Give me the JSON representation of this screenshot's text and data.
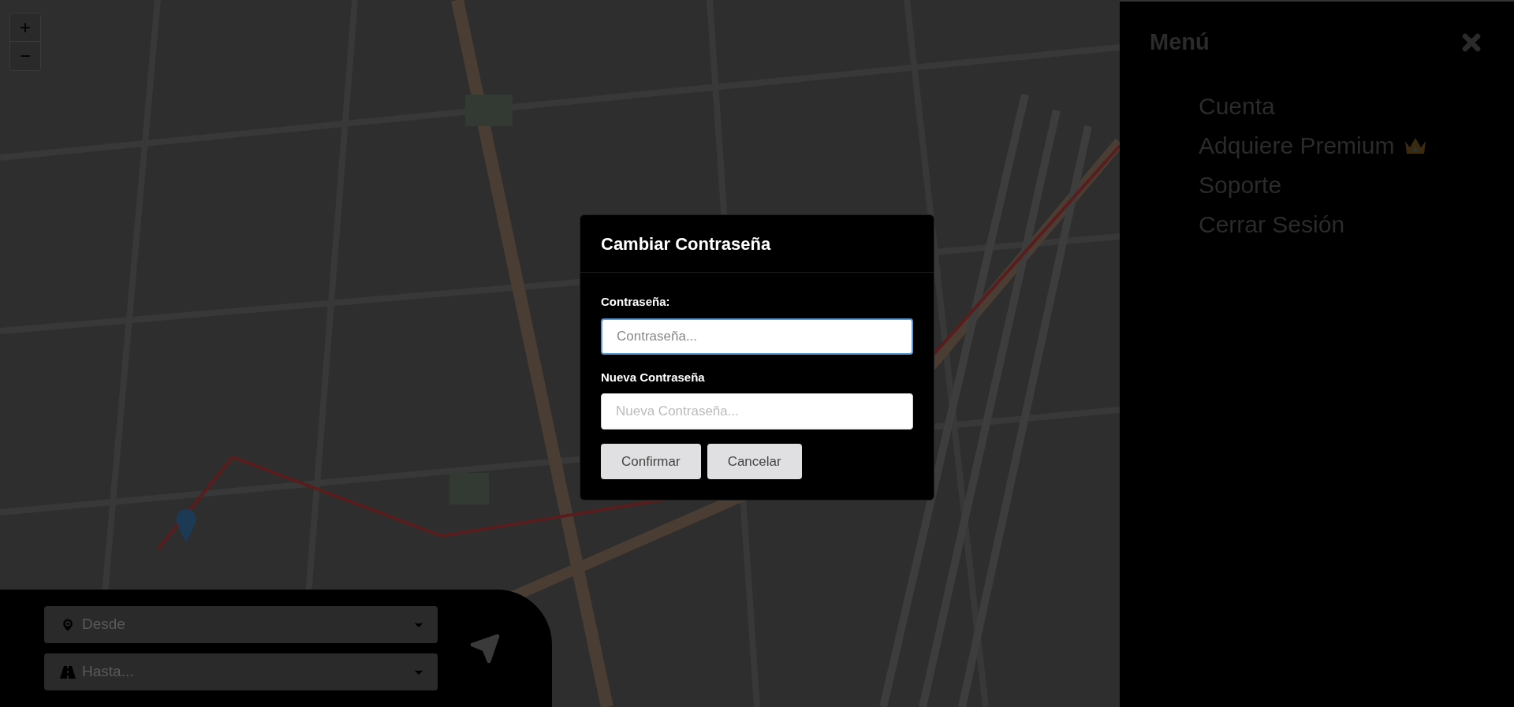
{
  "map": {
    "zoom_in": "+",
    "zoom_out": "−"
  },
  "route_panel": {
    "fields": [
      {
        "kind": "origin",
        "placeholder": "Desde"
      },
      {
        "kind": "destination",
        "placeholder": "Hasta..."
      }
    ]
  },
  "menu": {
    "title": "Menú",
    "items": [
      {
        "label": "Cuenta",
        "kind": "plain"
      },
      {
        "label": "Adquiere Premium",
        "kind": "premium"
      },
      {
        "label": "Soporte",
        "kind": "plain"
      },
      {
        "label": "Cerrar Sesión",
        "kind": "plain"
      }
    ]
  },
  "dialog": {
    "title": "Cambiar Contraseña",
    "fields": [
      {
        "label": "Contraseña:",
        "placeholder": "Contraseña...",
        "focused": true
      },
      {
        "label": "Nueva Contraseña",
        "placeholder": "Nueva Contraseña...",
        "focused": false
      }
    ],
    "buttons": [
      "Confirmar",
      "Cancelar"
    ]
  }
}
